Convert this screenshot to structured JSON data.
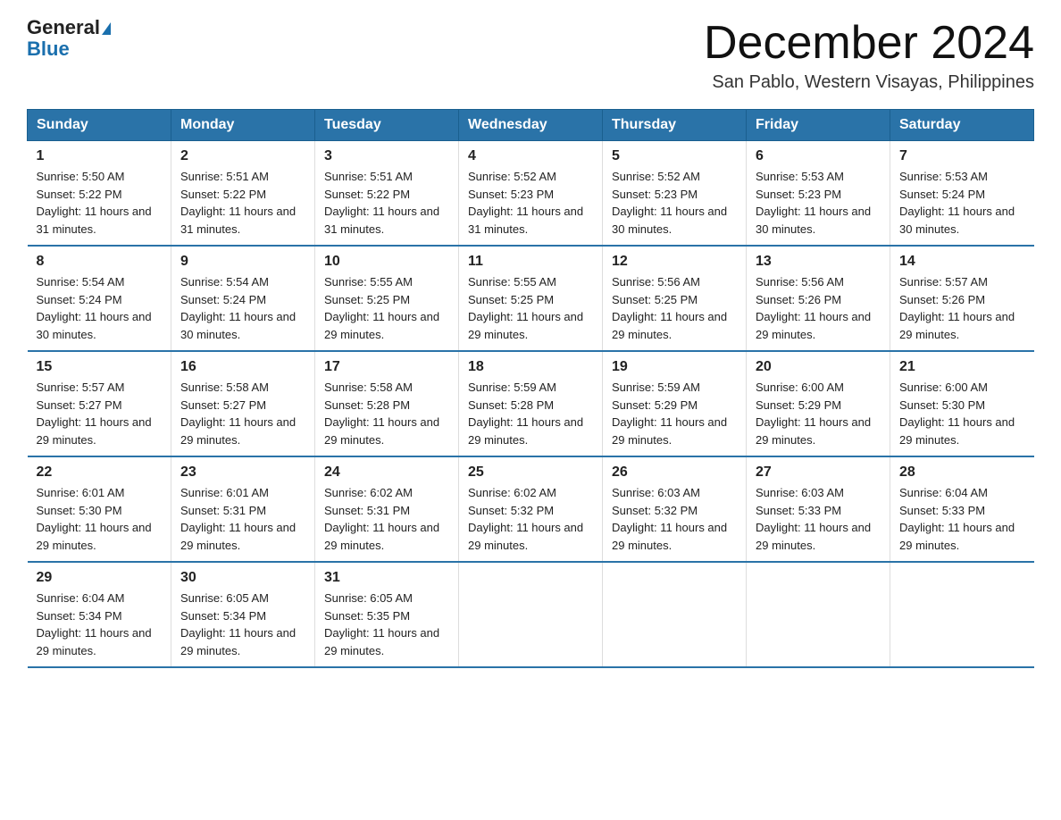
{
  "header": {
    "logo_general": "General",
    "logo_blue": "Blue",
    "month_title": "December 2024",
    "location": "San Pablo, Western Visayas, Philippines"
  },
  "days_of_week": [
    "Sunday",
    "Monday",
    "Tuesday",
    "Wednesday",
    "Thursday",
    "Friday",
    "Saturday"
  ],
  "weeks": [
    [
      {
        "day": "1",
        "sunrise": "5:50 AM",
        "sunset": "5:22 PM",
        "daylight": "11 hours and 31 minutes."
      },
      {
        "day": "2",
        "sunrise": "5:51 AM",
        "sunset": "5:22 PM",
        "daylight": "11 hours and 31 minutes."
      },
      {
        "day": "3",
        "sunrise": "5:51 AM",
        "sunset": "5:22 PM",
        "daylight": "11 hours and 31 minutes."
      },
      {
        "day": "4",
        "sunrise": "5:52 AM",
        "sunset": "5:23 PM",
        "daylight": "11 hours and 31 minutes."
      },
      {
        "day": "5",
        "sunrise": "5:52 AM",
        "sunset": "5:23 PM",
        "daylight": "11 hours and 30 minutes."
      },
      {
        "day": "6",
        "sunrise": "5:53 AM",
        "sunset": "5:23 PM",
        "daylight": "11 hours and 30 minutes."
      },
      {
        "day": "7",
        "sunrise": "5:53 AM",
        "sunset": "5:24 PM",
        "daylight": "11 hours and 30 minutes."
      }
    ],
    [
      {
        "day": "8",
        "sunrise": "5:54 AM",
        "sunset": "5:24 PM",
        "daylight": "11 hours and 30 minutes."
      },
      {
        "day": "9",
        "sunrise": "5:54 AM",
        "sunset": "5:24 PM",
        "daylight": "11 hours and 30 minutes."
      },
      {
        "day": "10",
        "sunrise": "5:55 AM",
        "sunset": "5:25 PM",
        "daylight": "11 hours and 29 minutes."
      },
      {
        "day": "11",
        "sunrise": "5:55 AM",
        "sunset": "5:25 PM",
        "daylight": "11 hours and 29 minutes."
      },
      {
        "day": "12",
        "sunrise": "5:56 AM",
        "sunset": "5:25 PM",
        "daylight": "11 hours and 29 minutes."
      },
      {
        "day": "13",
        "sunrise": "5:56 AM",
        "sunset": "5:26 PM",
        "daylight": "11 hours and 29 minutes."
      },
      {
        "day": "14",
        "sunrise": "5:57 AM",
        "sunset": "5:26 PM",
        "daylight": "11 hours and 29 minutes."
      }
    ],
    [
      {
        "day": "15",
        "sunrise": "5:57 AM",
        "sunset": "5:27 PM",
        "daylight": "11 hours and 29 minutes."
      },
      {
        "day": "16",
        "sunrise": "5:58 AM",
        "sunset": "5:27 PM",
        "daylight": "11 hours and 29 minutes."
      },
      {
        "day": "17",
        "sunrise": "5:58 AM",
        "sunset": "5:28 PM",
        "daylight": "11 hours and 29 minutes."
      },
      {
        "day": "18",
        "sunrise": "5:59 AM",
        "sunset": "5:28 PM",
        "daylight": "11 hours and 29 minutes."
      },
      {
        "day": "19",
        "sunrise": "5:59 AM",
        "sunset": "5:29 PM",
        "daylight": "11 hours and 29 minutes."
      },
      {
        "day": "20",
        "sunrise": "6:00 AM",
        "sunset": "5:29 PM",
        "daylight": "11 hours and 29 minutes."
      },
      {
        "day": "21",
        "sunrise": "6:00 AM",
        "sunset": "5:30 PM",
        "daylight": "11 hours and 29 minutes."
      }
    ],
    [
      {
        "day": "22",
        "sunrise": "6:01 AM",
        "sunset": "5:30 PM",
        "daylight": "11 hours and 29 minutes."
      },
      {
        "day": "23",
        "sunrise": "6:01 AM",
        "sunset": "5:31 PM",
        "daylight": "11 hours and 29 minutes."
      },
      {
        "day": "24",
        "sunrise": "6:02 AM",
        "sunset": "5:31 PM",
        "daylight": "11 hours and 29 minutes."
      },
      {
        "day": "25",
        "sunrise": "6:02 AM",
        "sunset": "5:32 PM",
        "daylight": "11 hours and 29 minutes."
      },
      {
        "day": "26",
        "sunrise": "6:03 AM",
        "sunset": "5:32 PM",
        "daylight": "11 hours and 29 minutes."
      },
      {
        "day": "27",
        "sunrise": "6:03 AM",
        "sunset": "5:33 PM",
        "daylight": "11 hours and 29 minutes."
      },
      {
        "day": "28",
        "sunrise": "6:04 AM",
        "sunset": "5:33 PM",
        "daylight": "11 hours and 29 minutes."
      }
    ],
    [
      {
        "day": "29",
        "sunrise": "6:04 AM",
        "sunset": "5:34 PM",
        "daylight": "11 hours and 29 minutes."
      },
      {
        "day": "30",
        "sunrise": "6:05 AM",
        "sunset": "5:34 PM",
        "daylight": "11 hours and 29 minutes."
      },
      {
        "day": "31",
        "sunrise": "6:05 AM",
        "sunset": "5:35 PM",
        "daylight": "11 hours and 29 minutes."
      },
      null,
      null,
      null,
      null
    ]
  ]
}
